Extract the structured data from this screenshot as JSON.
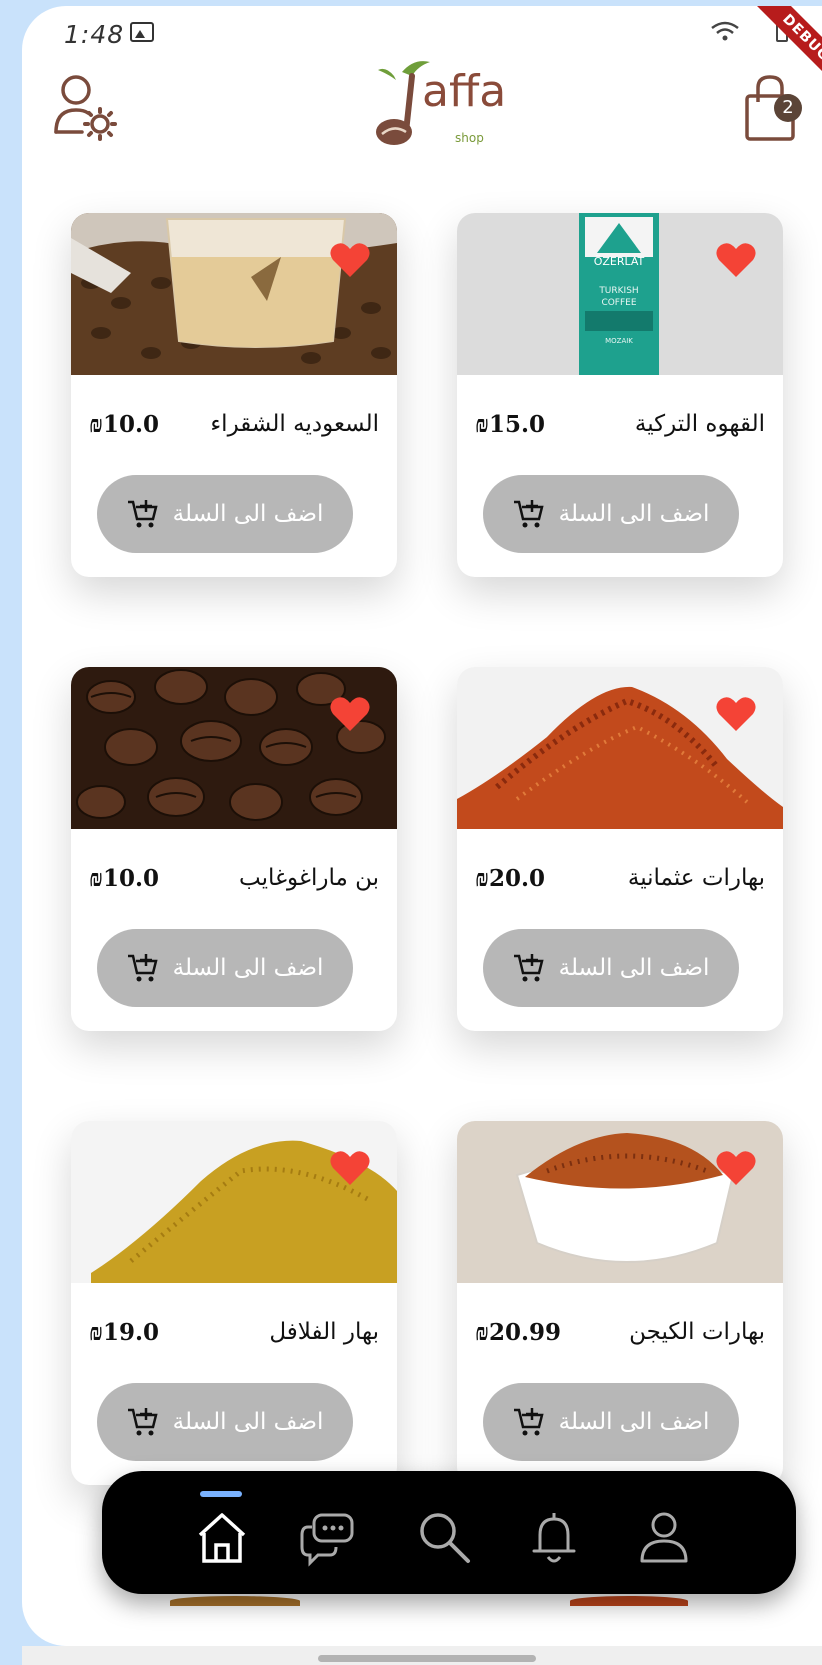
{
  "status_bar": {
    "time": "1:48",
    "debug_label": "DEBUG"
  },
  "header": {
    "brand_name": "affa",
    "brand_sub": "shop",
    "cart_count": "2",
    "icons": {
      "profile": "user-settings-icon",
      "cart": "shopping-bag-icon",
      "logo": "coffee-leaf-logo"
    }
  },
  "colors": {
    "accent": "#7a4b3c",
    "button": "#b7b7b7",
    "heart": "#f44336",
    "nav": "#000000",
    "nav_active": "#7ab2ff"
  },
  "products": [
    {
      "name": "السعوديه الشقراء",
      "price": "10.0",
      "currency": "₪",
      "button_label": "اضف الى السلة"
    },
    {
      "name": "القهوه التركية",
      "price": "15.0",
      "currency": "₪",
      "button_label": "اضف الى السلة"
    },
    {
      "name": "بن ماراغوغايب",
      "price": "10.0",
      "currency": "₪",
      "button_label": "اضف الى السلة"
    },
    {
      "name": "بهارات عثمانية",
      "price": "20.0",
      "currency": "₪",
      "button_label": "اضف الى السلة"
    },
    {
      "name": "بهار الفلافل",
      "price": "19.0",
      "currency": "₪",
      "button_label": "اضف الى السلة"
    },
    {
      "name": "بهارات الكيجن",
      "price": "20.99",
      "currency": "₪",
      "button_label": "اضف الى السلة"
    }
  ],
  "package_label": {
    "brand": "ÖZERLAT",
    "line1": "TURKISH",
    "line2": "COFFEE",
    "line3": "MOZAIK"
  },
  "bottom_nav": {
    "items": [
      {
        "icon": "home-icon",
        "active": true
      },
      {
        "icon": "chat-icon",
        "active": false
      },
      {
        "icon": "search-icon",
        "active": false
      },
      {
        "icon": "bell-icon",
        "active": false
      },
      {
        "icon": "user-icon",
        "active": false
      }
    ]
  }
}
